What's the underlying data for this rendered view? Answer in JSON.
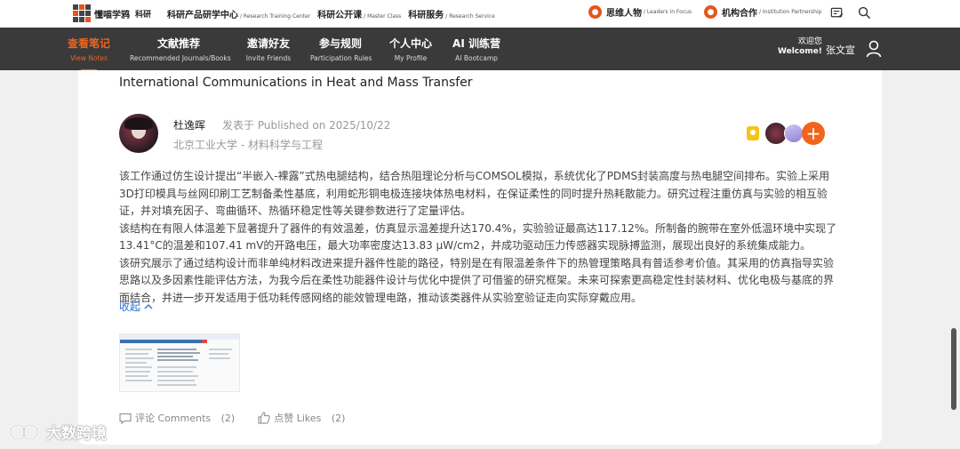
{
  "header": {
    "logo_text": "懂喵学鸦",
    "logo_sub": "科研",
    "links": [
      {
        "zh": "科研产品研学中心",
        "en": "/ Research Training Center"
      },
      {
        "zh": "科研公开课",
        "en": "/ Master Class"
      },
      {
        "zh": "科研服务",
        "en": "/ Research Service"
      }
    ],
    "right_links": [
      {
        "zh": "思维人物",
        "en": "/ Leaders in Focus"
      },
      {
        "zh": "机构合作",
        "en": "/ Institution Partnership"
      }
    ]
  },
  "nav": {
    "items": [
      {
        "zh": "查看笔记",
        "en": "View Notes",
        "active": true
      },
      {
        "zh": "文献推荐",
        "en": "Recommended Journals/Books"
      },
      {
        "zh": "邀请好友",
        "en": "Invite Friends"
      },
      {
        "zh": "参与规则",
        "en": "Participation Rules"
      },
      {
        "zh": "个人中心",
        "en": "My Profile"
      },
      {
        "zh": "AI 训练营",
        "en": "AI Bootcamp"
      }
    ],
    "welcome_zh": "欢迎您",
    "welcome_en": "Welcome!",
    "username": "张文宣"
  },
  "post": {
    "journal": "International Communications in Heat and Mass Transfer",
    "author": "杜逸晖",
    "posted": "发表于 Published on 2025/10/22",
    "affiliation": "北京工业大学 - 材料科学与工程",
    "paragraphs": [
      "该工作通过仿生设计提出“半嵌入-裸露”式热电腿结构，结合热阻理论分析与COMSOL模拟，系统优化了PDMS封装高度与热电腿空间排布。实验上采用3D打印模具与丝网印刷工艺制备柔性基底，利用蛇形铜电极连接块体热电材料，在保证柔性的同时提升热耗散能力。研究过程注重仿真与实验的相互验证，并对填充因子、弯曲循环、热循环稳定性等关键参数进行了定量评估。",
      "该结构在有限人体温差下显著提升了器件的有效温差，仿真显示温差提升达170.4%，实验验证最高达117.12%。所制备的腕带在室外低温环境中实现了13.41°C的温差和107.41 mV的开路电压，最大功率密度达13.83 μW/cm2，并成功驱动压力传感器实现脉搏监测，展现出良好的系统集成能力。",
      "该研究展示了通过结构设计而非单纯材料改进来提升器件性能的路径，特别是在有限温差条件下的热管理策略具有普适参考价值。其采用的仿真指导实验思路以及多因素性能评估方法，为我今后在柔性功能器件设计与优化中提供了可借鉴的研究框架。未来可探索更高稳定性封装材料、优化电极与基底的界面结合，并进一步开发适用于低功耗传感网络的能效管理电路，推动该类器件从实验室验证走向实际穿戴应用。"
    ],
    "collapse_label": "收起",
    "comments_label": "评论 Comments",
    "comments_count": "(2)",
    "likes_label": "点赞 Likes",
    "likes_count": "(2)"
  },
  "watermark": "大数跨境",
  "colors": {
    "accent": "#f0641e",
    "nav_bg": "#3a3a3a",
    "link": "#2a6fd0"
  }
}
